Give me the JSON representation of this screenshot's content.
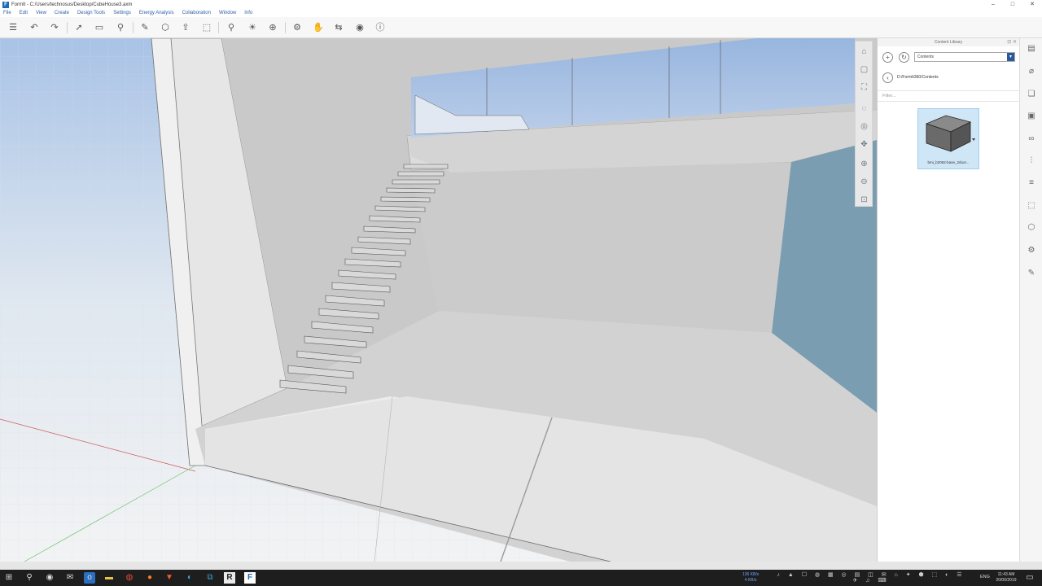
{
  "window": {
    "title": "FormIt - C:/Users/technosus/Desktop/CubeHouse3.axm",
    "controls": [
      "–",
      "□",
      "✕"
    ]
  },
  "menu": [
    "File",
    "Edit",
    "View",
    "Create",
    "Design Tools",
    "Settings",
    "Energy Analysis",
    "Collaboration",
    "Window",
    "Info"
  ],
  "toolbar": {
    "icons": [
      "layers-icon",
      "undo-icon",
      "redo-icon",
      "select-icon",
      "measure-icon",
      "paint-icon",
      "pencil-icon",
      "cube-icon",
      "push-pull-icon",
      "frame-icon",
      "location-icon",
      "sun-icon",
      "orbit-icon",
      "gear-icon",
      "hand-icon",
      "share-icon",
      "account-icon",
      "info-icon"
    ]
  },
  "viewport_nav": [
    "home-view-icon",
    "cube-view-icon",
    "section-icon",
    "orbit-icon",
    "look-icon",
    "walk-icon",
    "zoom-in-icon",
    "zoom-out-icon",
    "zoom-fit-icon"
  ],
  "content_library": {
    "header": "Content Library",
    "header_buttons": "⊡ ✕",
    "source_select": "Contents",
    "path": "D:/FormIt360/Contents",
    "filter_placeholder": "Filter...",
    "items": [
      {
        "label": "bmi_b2062-base_2door..."
      }
    ]
  },
  "right_strip": [
    "properties-icon",
    "materials-icon",
    "layers-icon",
    "groups-icon",
    "scenes-icon",
    "levels-icon",
    "sketch-icon",
    "content-library-icon",
    "cube-library-icon",
    "dynamo-icon",
    "plugin-icon"
  ],
  "taskbar": {
    "icons": [
      "windows-icon",
      "search-icon",
      "chrome-icon",
      "mail-icon",
      "outlook-icon",
      "folder-icon",
      "chrome2-icon",
      "firefox-icon",
      "brave-icon",
      "edge-icon",
      "network-icon",
      "revit-icon",
      "formit-icon"
    ],
    "network_speed": "136 KB/s\n4 KB/s",
    "language": "ENG",
    "time": "11:43 AM",
    "date": "20/06/2019"
  }
}
